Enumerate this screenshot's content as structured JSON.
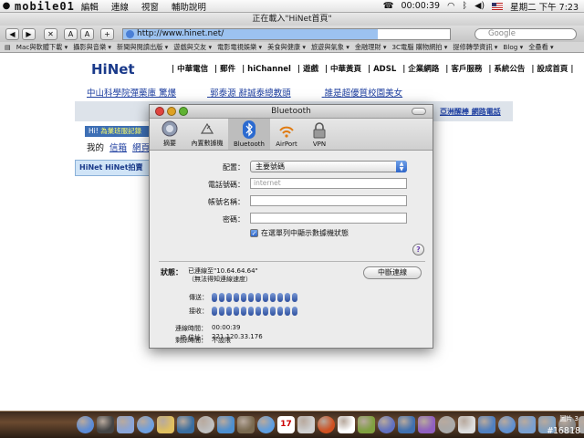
{
  "menubar": {
    "logo": "mobile01",
    "menus": [
      "編輯",
      "編輯",
      "連線",
      "視窗",
      "輔助說明"
    ],
    "clock": "00:00:39",
    "datetime": "星期二 下午 7:23",
    "flag_color": "#b22222"
  },
  "browser": {
    "title": "正在載入\"HiNet首頁\"",
    "url": "http://www.hinet.net/",
    "search_placeholder": "Google",
    "buttons": {
      "back": "◀",
      "forward": "▶",
      "stop": "✕",
      "text_smaller": "A",
      "text_bigger": "A",
      "add": "+"
    },
    "bookmarks": [
      "Mac與軟體下載 ▾",
      "攝影與音樂 ▾",
      "新聞與閱讀出版 ▾",
      "遊戲與交友 ▾",
      "電影電視娛樂 ▾",
      "美食與健康 ▾",
      "旅遊與氣象 ▾",
      "金融理財 ▾",
      "3C電腦 購物網拍 ▾",
      "提修轉學資訊 ▾",
      "Blog ▾",
      "全壘看 ▾"
    ]
  },
  "webpage": {
    "logo": "HiNet",
    "nav": [
      "| 中華電信",
      "| 郵件",
      "| hiChannel",
      "| 遊戲",
      "| 中華黃頁",
      "| ADSL",
      "| 企業網路",
      "| 客戶服務",
      "| 系統公告",
      "| 設成首頁 |"
    ],
    "headlines": [
      "中山科學院彈藥庫 驚爆",
      "郭泰源 辭誠泰總教頭",
      "誰是超優質校園美女"
    ],
    "right_links": "亞洲醒棒  網路電話",
    "hi_prefix": "Hi!",
    "hi_text": "為業班服記錄",
    "my_label": "我的",
    "my_links": [
      "信箱",
      "網頁",
      "邀"
    ],
    "promo": "HiNet HiNet拍賣"
  },
  "bluetooth": {
    "title": "Bluetooth",
    "tabs": [
      {
        "label": "摘要",
        "icon": "summary-icon"
      },
      {
        "label": "內置數據機",
        "icon": "modem-icon"
      },
      {
        "label": "Bluetooth",
        "icon": "bluetooth-icon"
      },
      {
        "label": "AirPort",
        "icon": "airport-icon"
      },
      {
        "label": "VPN",
        "icon": "vpn-icon"
      }
    ],
    "config_label": "配置：",
    "config_value": "主要號碼",
    "phone_label": "電話號碼：",
    "phone_placeholder": "internet",
    "account_label": "帳號名稱：",
    "password_label": "密碼：",
    "show_status_label": "在選單列中顯示數據機狀態",
    "show_status_checked": true,
    "help": "?",
    "status_label": "狀態：",
    "status_line1": "已連線至\"10.64.64.64\"",
    "status_line2": "（無法得知連線速度）",
    "disconnect": "中斷連線",
    "send_label": "傳送：",
    "receive_label": "接收：",
    "send_level": 1.0,
    "receive_level": 1.0,
    "connect_time_label": "連線時間：",
    "connect_time": "00:00:39",
    "remaining_label": "剩餘時間：",
    "remaining": "不設限",
    "ip_label": "IP 位址：",
    "ip": "221.120.33.176"
  },
  "dock": {
    "calendar_day": "17",
    "right_label": "圖片 3",
    "credit": "#16818",
    "icon_colors": [
      "#5b8bd6",
      "#444",
      "#8aa5d8",
      "#6ea0e0",
      "#e0c060",
      "#3a6ea0",
      "#c0c0c0",
      "#4d8fd0",
      "#7a6a50",
      "#5e9ee0",
      "#b07030",
      "#d0d0d0",
      "#d05020",
      "#ffffff",
      "#80a040",
      "#6070c0",
      "#4070b0",
      "#9060c0",
      "#aaa",
      "#ddd",
      "#5080c0",
      "#6090d0",
      "#7aa0d0",
      "#80a0c0",
      "#888",
      "#aaa"
    ]
  }
}
